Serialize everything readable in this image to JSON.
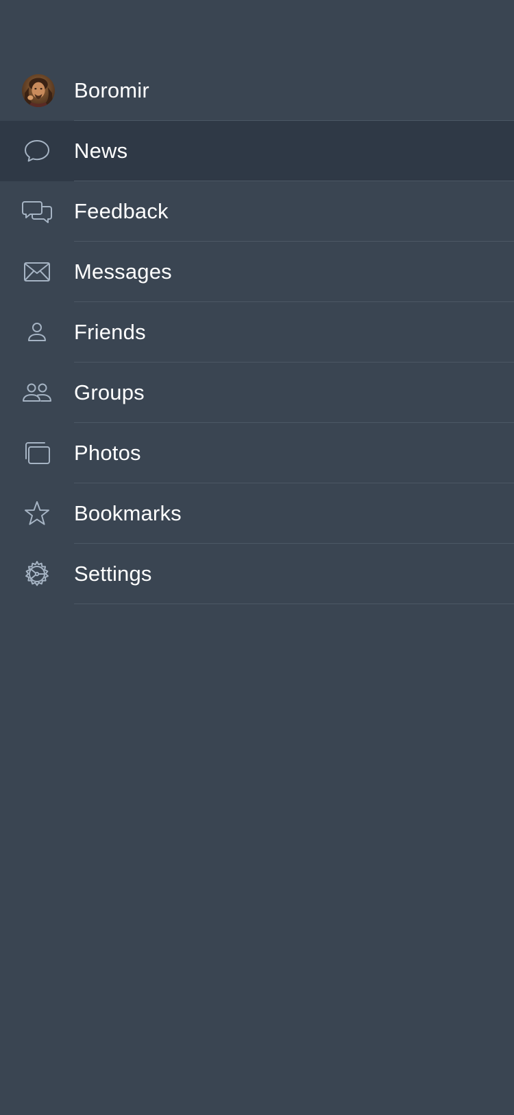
{
  "profile": {
    "name": "Boromir",
    "avatar_icon": "user-avatar"
  },
  "menu": {
    "selected": "News",
    "items": [
      {
        "label": "News",
        "icon": "speech-bubble-icon"
      },
      {
        "label": "Feedback",
        "icon": "chat-bubbles-icon"
      },
      {
        "label": "Messages",
        "icon": "envelope-icon"
      },
      {
        "label": "Friends",
        "icon": "person-icon"
      },
      {
        "label": "Groups",
        "icon": "people-icon"
      },
      {
        "label": "Photos",
        "icon": "photos-icon"
      },
      {
        "label": "Bookmarks",
        "icon": "star-icon"
      },
      {
        "label": "Settings",
        "icon": "gear-icon"
      }
    ]
  },
  "colors": {
    "background": "#3a4552",
    "selected_row": "#2f3946",
    "divider": "#4c5865",
    "icon_stroke": "#a6b4c4",
    "text": "#ffffff"
  }
}
